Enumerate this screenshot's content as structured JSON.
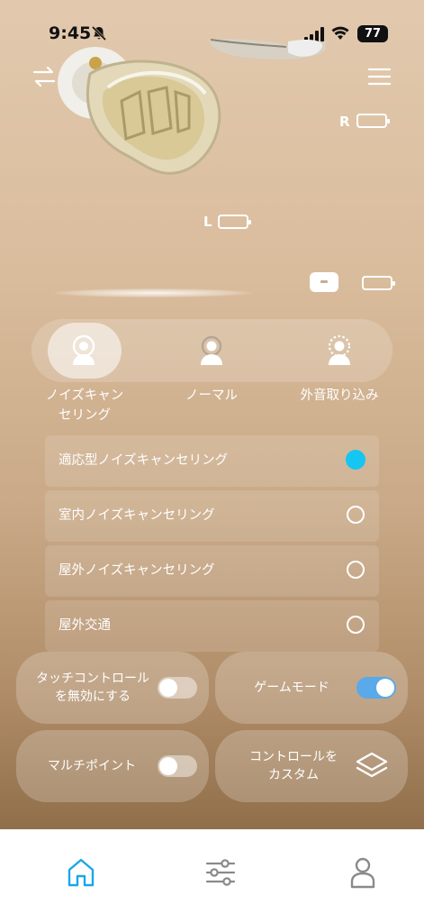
{
  "status_bar": {
    "time": "9:45",
    "battery": "77",
    "icons": [
      "bell-slash-icon",
      "signal-icon",
      "wifi-icon",
      "battery-icon"
    ]
  },
  "header": {
    "icons": [
      "swap-icon",
      "menu-icon"
    ]
  },
  "earbuds": {
    "right_label": "R",
    "left_label": "L"
  },
  "modes": {
    "items": [
      {
        "label": "ノイズキャン\nセリング",
        "icon": "anc-person-icon",
        "active": true
      },
      {
        "label": "ノーマル",
        "icon": "normal-person-icon",
        "active": false
      },
      {
        "label": "外音取り込み",
        "icon": "ambient-person-icon",
        "active": false
      }
    ]
  },
  "anc_options": [
    {
      "label": "適応型ノイズキャンセリング",
      "selected": true
    },
    {
      "label": "室内ノイズキャンセリング",
      "selected": false
    },
    {
      "label": "屋外ノイズキャンセリング",
      "selected": false
    },
    {
      "label": "屋外交通",
      "selected": false
    }
  ],
  "controls": {
    "touch_label": "タッチコントロール\nを無効にする",
    "touch_on": false,
    "game_label": "ゲームモード",
    "game_on": true,
    "multi_label": "マルチポイント",
    "multi_on": false,
    "custom_label": "コントロールを\nカスタム"
  },
  "bottom_nav": {
    "items": [
      "home-icon",
      "equalizer-icon",
      "profile-icon"
    ],
    "active": "home-icon"
  },
  "colors": {
    "accent": "#16c6f2",
    "toggle_on": "#5aa9e8",
    "nav_active": "#1aa7e8",
    "nav_inactive": "#8a8a8a"
  }
}
